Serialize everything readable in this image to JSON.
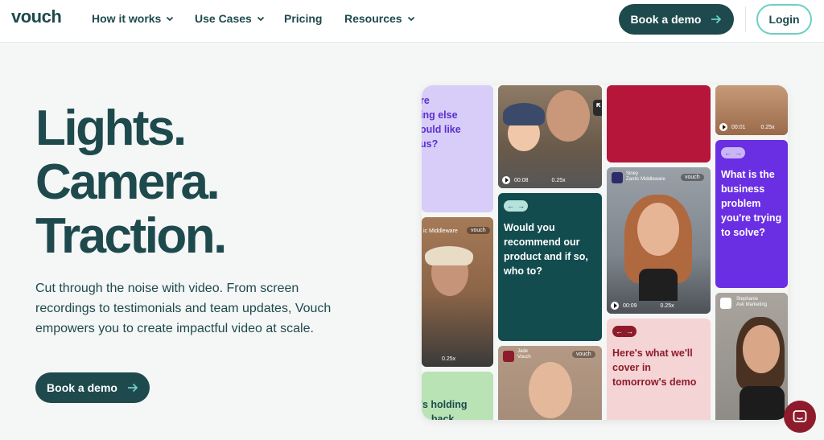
{
  "nav": {
    "logo": "vouch",
    "items": [
      {
        "label": "How it works",
        "has_dropdown": true
      },
      {
        "label": "Use Cases",
        "has_dropdown": true
      },
      {
        "label": "Pricing",
        "has_dropdown": false
      },
      {
        "label": "Resources",
        "has_dropdown": true
      }
    ],
    "book_demo": "Book a demo",
    "login": "Login"
  },
  "hero": {
    "title_lines": [
      "Lights.",
      "Camera.",
      "Traction."
    ],
    "subtitle": "Cut through the noise with video. From screen recordings to testimonials and team updates, Vouch empowers you to create impactful video at scale.",
    "cta": "Book a demo"
  },
  "collage": {
    "tile_purple_left_text": "re\ning else\nould like\nus?",
    "tile_green_bottom_text": "'s holding\n... back",
    "tile_teal_question": "Would you recommend our product and if so, who to?",
    "tile_pink_question": "Here's what we'll cover in tomorrow's demo",
    "tile_violet_question": "What is the business problem you're trying to solve?",
    "video1": {
      "time": "00:08",
      "speed": "0.25x"
    },
    "video2": {
      "time": "00:09",
      "speed": "0.25x"
    },
    "video3": {
      "time": "00:01",
      "speed": "0.25x"
    },
    "video_left": {
      "speed": "0.25x",
      "caption": "ic Middleware"
    },
    "card_siney": {
      "name": "Siney",
      "company": "Zantic Middleware",
      "tag": "vouch"
    },
    "card_jade": {
      "name": "Jade",
      "company": "Vouch",
      "tag": "vouch"
    },
    "card_stephanie": {
      "name": "Stephanie",
      "company": "Ask Marketing"
    },
    "card_left_tag": "vouch"
  },
  "colors": {
    "brand_dark": "#1e4a4d",
    "accent_teal": "#6ccfc4",
    "purple_light": "#d8cdf8",
    "crimson": "#b5163a",
    "violet": "#6a2fe3",
    "teal_dark": "#134c4f",
    "pink_light": "#f4d4d4",
    "green_light": "#b9e3b4",
    "chat_bubble": "#8e1b2b"
  },
  "icons": [
    "chevron-down-icon",
    "arrow-right-icon",
    "expand-icon",
    "chat-icon",
    "play-icon"
  ]
}
